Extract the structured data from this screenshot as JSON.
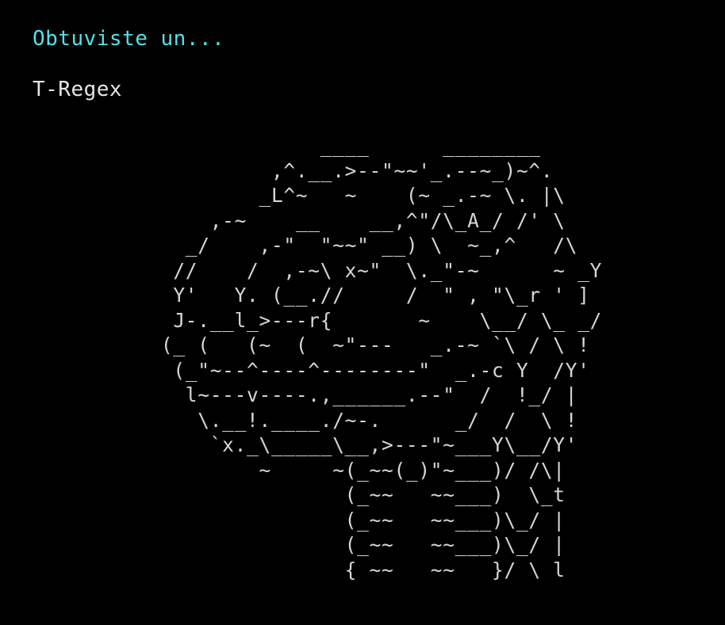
{
  "colors": {
    "background": "#000000",
    "heading": "#4FE3E8",
    "text": "#E6E6E6",
    "art": "#D6D6D6"
  },
  "heading": "Obtuviste un...",
  "result": "T-Regex",
  "ascii_art": "               ____      ________\n           ,^.__.>--\"~~'_.--~_)~^.\n          _L^~   ~    (~ _.-~ \\. |\\\n      ,-~    __    __,^\"/\\_A_/ /' \\\n    _/    ,-\"  \"~~\" __) \\  ~_,^   /\\\n   //    /  ,-~\\ x~\"  \\._\"-~      ~ _Y\n   Y'   Y. (__.//     /  \" , \"\\_r ' ]\n   J-.__l_>---r{       ~    \\__/ \\_ _/\n  (_ (   (~  (  ~\"---   _.-~ `\\ / \\ !\n   (_\"~--^----^--------\"  _.-c Y  /Y'\n    l~---v----.,______.--\"  /  !_/ |\n     \\.__!.____./~-.      _/  /  \\ !\n      `x._\\_____\\__,>---\"~___Y\\__/Y'\n          ~     ~(_~~(_)\"~___)/ /\\|\n                 (_~~   ~~___)  \\_t\n                 (_~~   ~~___)\\_/ |\n                 (_~~   ~~___)\\_/ |\n                 { ~~   ~~   }/ \\ l"
}
